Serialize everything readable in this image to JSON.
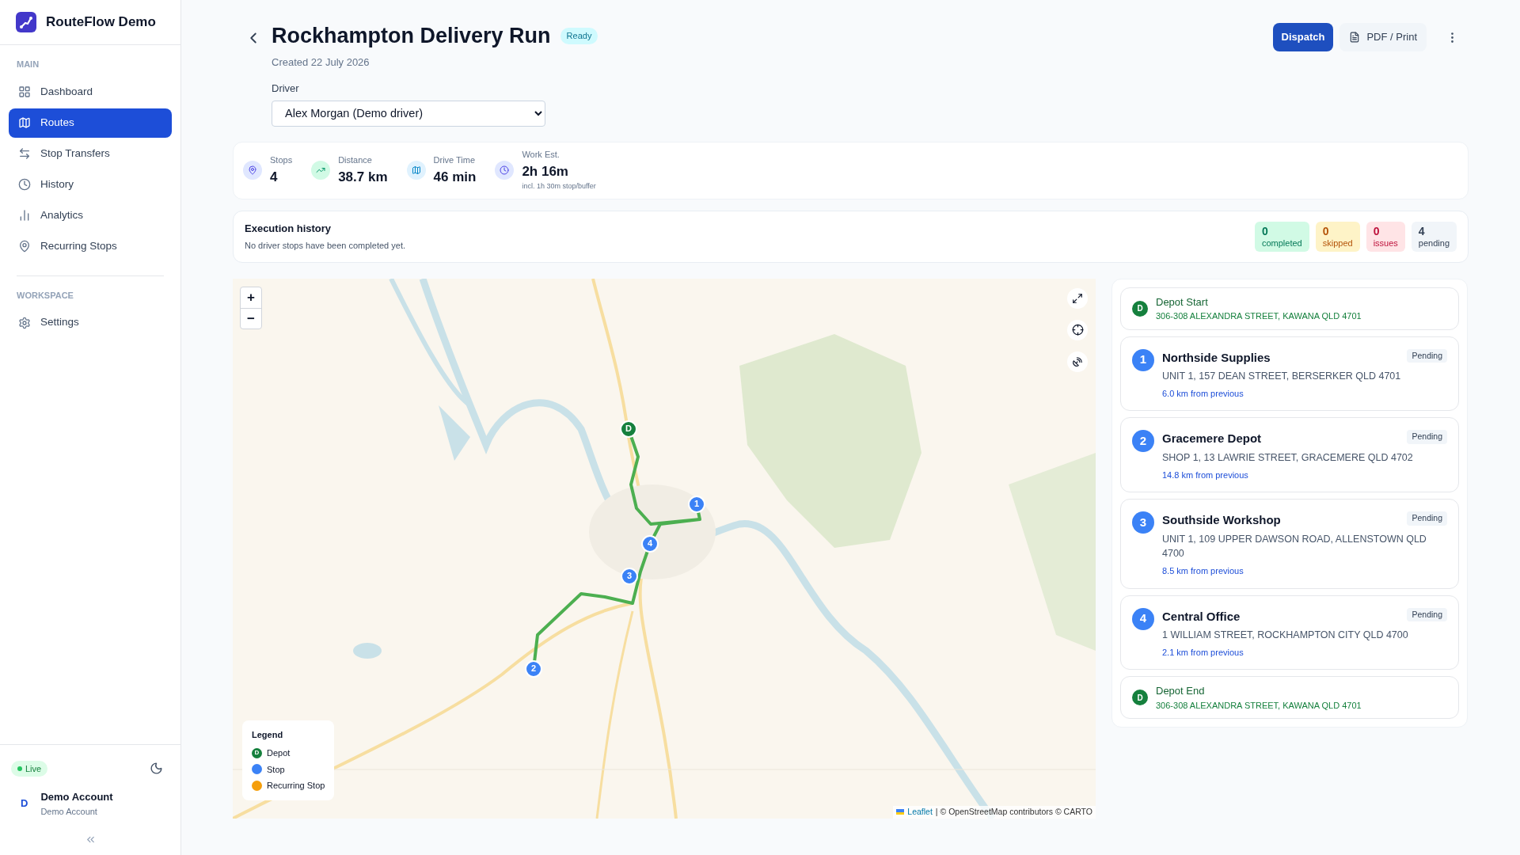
{
  "app": {
    "name": "RouteFlow Demo"
  },
  "sidebar": {
    "sections": [
      {
        "heading": "MAIN",
        "items": [
          {
            "label": "Dashboard",
            "selected": false
          },
          {
            "label": "Routes",
            "selected": true
          },
          {
            "label": "Stop Transfers",
            "selected": false
          },
          {
            "label": "History",
            "selected": false
          },
          {
            "label": "Analytics",
            "selected": false
          },
          {
            "label": "Recurring Stops",
            "selected": false
          }
        ]
      },
      {
        "heading": "WORKSPACE",
        "items": [
          {
            "label": "Settings",
            "selected": false
          }
        ]
      }
    ],
    "status": "Live",
    "account": {
      "initial": "D",
      "name": "Demo Account",
      "subtitle": "Demo Account"
    }
  },
  "header": {
    "title": "Rockhampton Delivery Run",
    "status": "Ready",
    "created": "Created 22 July 2026",
    "driver_label": "Driver",
    "driver": "Alex Morgan (Demo driver)",
    "actions": [
      {
        "kind": "primary",
        "label": "Dispatch"
      },
      {
        "kind": "secondary",
        "label": "PDF / Print"
      }
    ]
  },
  "stats": [
    {
      "label": "Stops",
      "value": "4"
    },
    {
      "label": "Distance",
      "value": "38.7 km"
    },
    {
      "label": "Drive Time",
      "value": "46 min"
    },
    {
      "label": "Work Est.",
      "value": "2h 16m",
      "note": "incl. 1h 30m stop/buffer"
    }
  ],
  "execution": {
    "title": "Execution history",
    "message": "No driver stops have been completed yet.",
    "counts": [
      {
        "value": "0",
        "label": "completed",
        "color": "#047857"
      },
      {
        "value": "0",
        "label": "skipped",
        "color": "#b45309"
      },
      {
        "value": "0",
        "label": "issues",
        "color": "#be123c"
      },
      {
        "value": "4",
        "label": "pending",
        "color": "#334155"
      }
    ]
  },
  "map": {
    "zoom": [
      "+",
      "−"
    ],
    "markers": [
      {
        "kind": "depot",
        "label": "D"
      },
      {
        "kind": "stop",
        "label": "1"
      },
      {
        "kind": "stop",
        "label": "4"
      },
      {
        "kind": "stop",
        "label": "3"
      },
      {
        "kind": "stop",
        "label": "2"
      }
    ],
    "legend": {
      "title": "Legend",
      "items": [
        {
          "label": "Depot",
          "color": "#15803d",
          "mark": "D"
        },
        {
          "label": "Stop",
          "color": "#3b82f6"
        },
        {
          "label": "Recurring Stop",
          "color": "#f59e0b"
        }
      ]
    },
    "attribution": {
      "link": "Leaflet",
      "text": "| © OpenStreetMap contributors © CARTO"
    }
  },
  "stops": [
    {
      "kind": "depot",
      "badge": "D",
      "name": "Depot Start",
      "address": "306-308 ALEXANDRA STREET, KAWANA QLD 4701"
    },
    {
      "kind": "stop",
      "badge": "1",
      "name": "Northside Supplies",
      "status": "Pending",
      "address": "UNIT 1, 157 DEAN STREET, BERSERKER QLD 4701",
      "distance": "6.0 km from previous"
    },
    {
      "kind": "stop",
      "badge": "2",
      "name": "Gracemere Depot",
      "status": "Pending",
      "address": "SHOP 1, 13 LAWRIE STREET, GRACEMERE QLD 4702",
      "distance": "14.8 km from previous"
    },
    {
      "kind": "stop",
      "badge": "3",
      "name": "Southside Workshop",
      "status": "Pending",
      "address": "UNIT 1, 109 UPPER DAWSON ROAD, ALLENSTOWN QLD 4700",
      "distance": "8.5 km from previous"
    },
    {
      "kind": "stop",
      "badge": "4",
      "name": "Central Office",
      "status": "Pending",
      "address": "1 WILLIAM STREET, ROCKHAMPTON CITY QLD 4700",
      "distance": "2.1 km from previous"
    },
    {
      "kind": "depot",
      "badge": "D",
      "name": "Depot End",
      "address": "306-308 ALEXANDRA STREET, KAWANA QLD 4701"
    }
  ]
}
